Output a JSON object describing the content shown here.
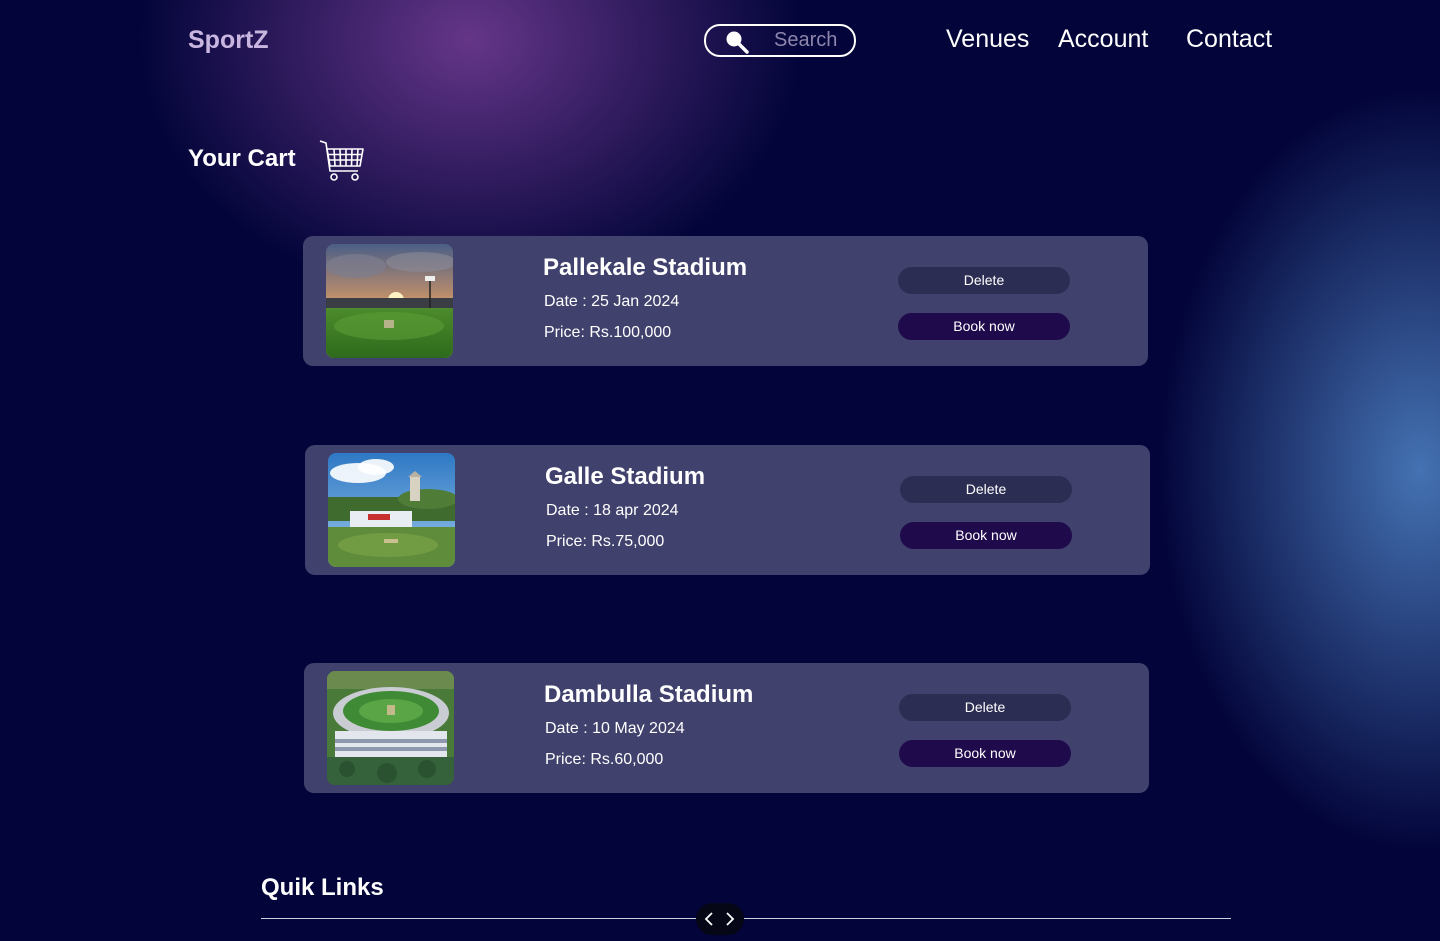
{
  "header": {
    "logo": "SportZ",
    "search_placeholder": "Search",
    "nav": [
      "Venues",
      "Account",
      "Contact"
    ]
  },
  "cart": {
    "title": "Your Cart",
    "items": [
      {
        "name": "Pallekale Stadium",
        "date": "Date : 25 Jan 2024",
        "price": "Price: Rs.100,000",
        "delete_label": "Delete",
        "book_label": "Book now",
        "image": "pallekale-stadium-photo"
      },
      {
        "name": "Galle Stadium",
        "date": "Date : 18 apr 2024",
        "price": "Price: Rs.75,000",
        "delete_label": "Delete",
        "book_label": "Book now",
        "image": "galle-stadium-photo"
      },
      {
        "name": "Dambulla Stadium",
        "date": "Date : 10 May 2024",
        "price": "Price: Rs.60,000",
        "delete_label": "Delete",
        "book_label": "Book now",
        "image": "dambulla-stadium-photo"
      }
    ]
  },
  "footer": {
    "quick_links_title": "Quik Links"
  },
  "icons": [
    "search-icon",
    "cart-icon",
    "chevron-left-icon",
    "chevron-right-icon"
  ],
  "colors": {
    "background": "#03053a",
    "card": "#40416c",
    "delete_button": "#2c2d53",
    "book_button": "#1f0a4c",
    "logo": "#c9b6e0"
  }
}
